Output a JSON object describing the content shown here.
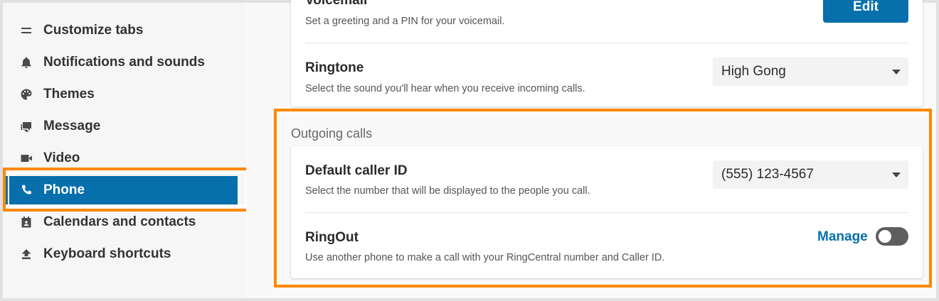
{
  "sidebar": {
    "items": [
      {
        "label": "Customize tabs",
        "icon": "menu-lines-icon",
        "active": false
      },
      {
        "label": "Notifications and sounds",
        "icon": "bell-icon",
        "active": false
      },
      {
        "label": "Themes",
        "icon": "palette-icon",
        "active": false
      },
      {
        "label": "Message",
        "icon": "chat-bubbles-icon",
        "active": false
      },
      {
        "label": "Video",
        "icon": "video-camera-icon",
        "active": false
      },
      {
        "label": "Phone",
        "icon": "phone-icon",
        "active": true
      },
      {
        "label": "Calendars and contacts",
        "icon": "calendar-person-icon",
        "active": false
      },
      {
        "label": "Keyboard shortcuts",
        "icon": "upload-arrow-icon",
        "active": false
      }
    ]
  },
  "voicemail": {
    "title": "Voicemail",
    "description": "Set a greeting and a PIN for your voicemail.",
    "button_label": "Edit"
  },
  "ringtone": {
    "title": "Ringtone",
    "description": "Select the sound you'll hear when you receive incoming calls.",
    "selected": "High Gong"
  },
  "outgoing": {
    "section_label": "Outgoing calls",
    "caller_id": {
      "title": "Default caller ID",
      "description": "Select the number that will be displayed to the people you call.",
      "selected": "(555) 123-4567"
    },
    "ringout": {
      "title": "RingOut",
      "description": "Use another phone to make a call with your RingCentral number and Caller ID.",
      "manage_label": "Manage",
      "enabled": false
    }
  },
  "colors": {
    "accent": "#066fac",
    "highlight": "#ff8800",
    "sidebar_bg": "#f6f6f6"
  }
}
